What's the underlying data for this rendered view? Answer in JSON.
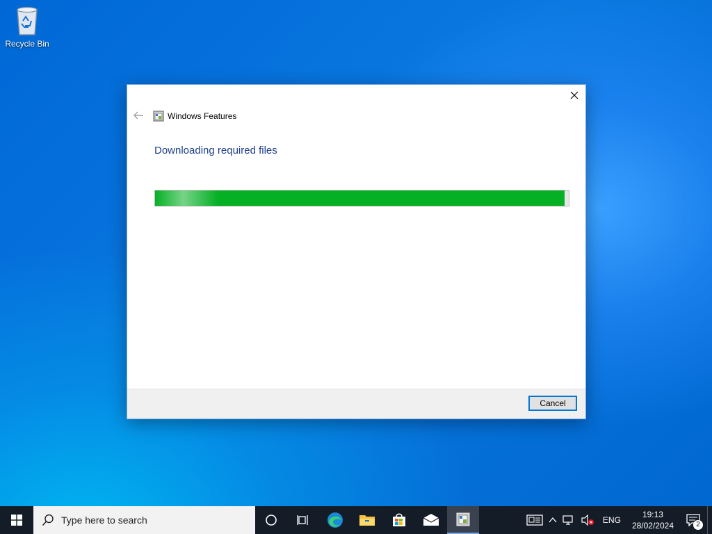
{
  "desktop": {
    "recycle_bin_label": "Recycle Bin"
  },
  "dialog": {
    "title": "Windows Features",
    "heading": "Downloading required files",
    "progress_fraction": 0.99,
    "cancel_label": "Cancel",
    "accent_color": "#06b025",
    "heading_color": "#1e3f8c"
  },
  "taskbar": {
    "search_placeholder": "Type here to search",
    "pinned": [
      "task-view-icon",
      "edge-icon",
      "file-explorer-icon",
      "store-icon",
      "mail-icon",
      "windows-features-icon"
    ],
    "tray": {
      "language": "ENG",
      "time": "19:13",
      "date": "28/02/2024",
      "notification_count": "2"
    }
  }
}
